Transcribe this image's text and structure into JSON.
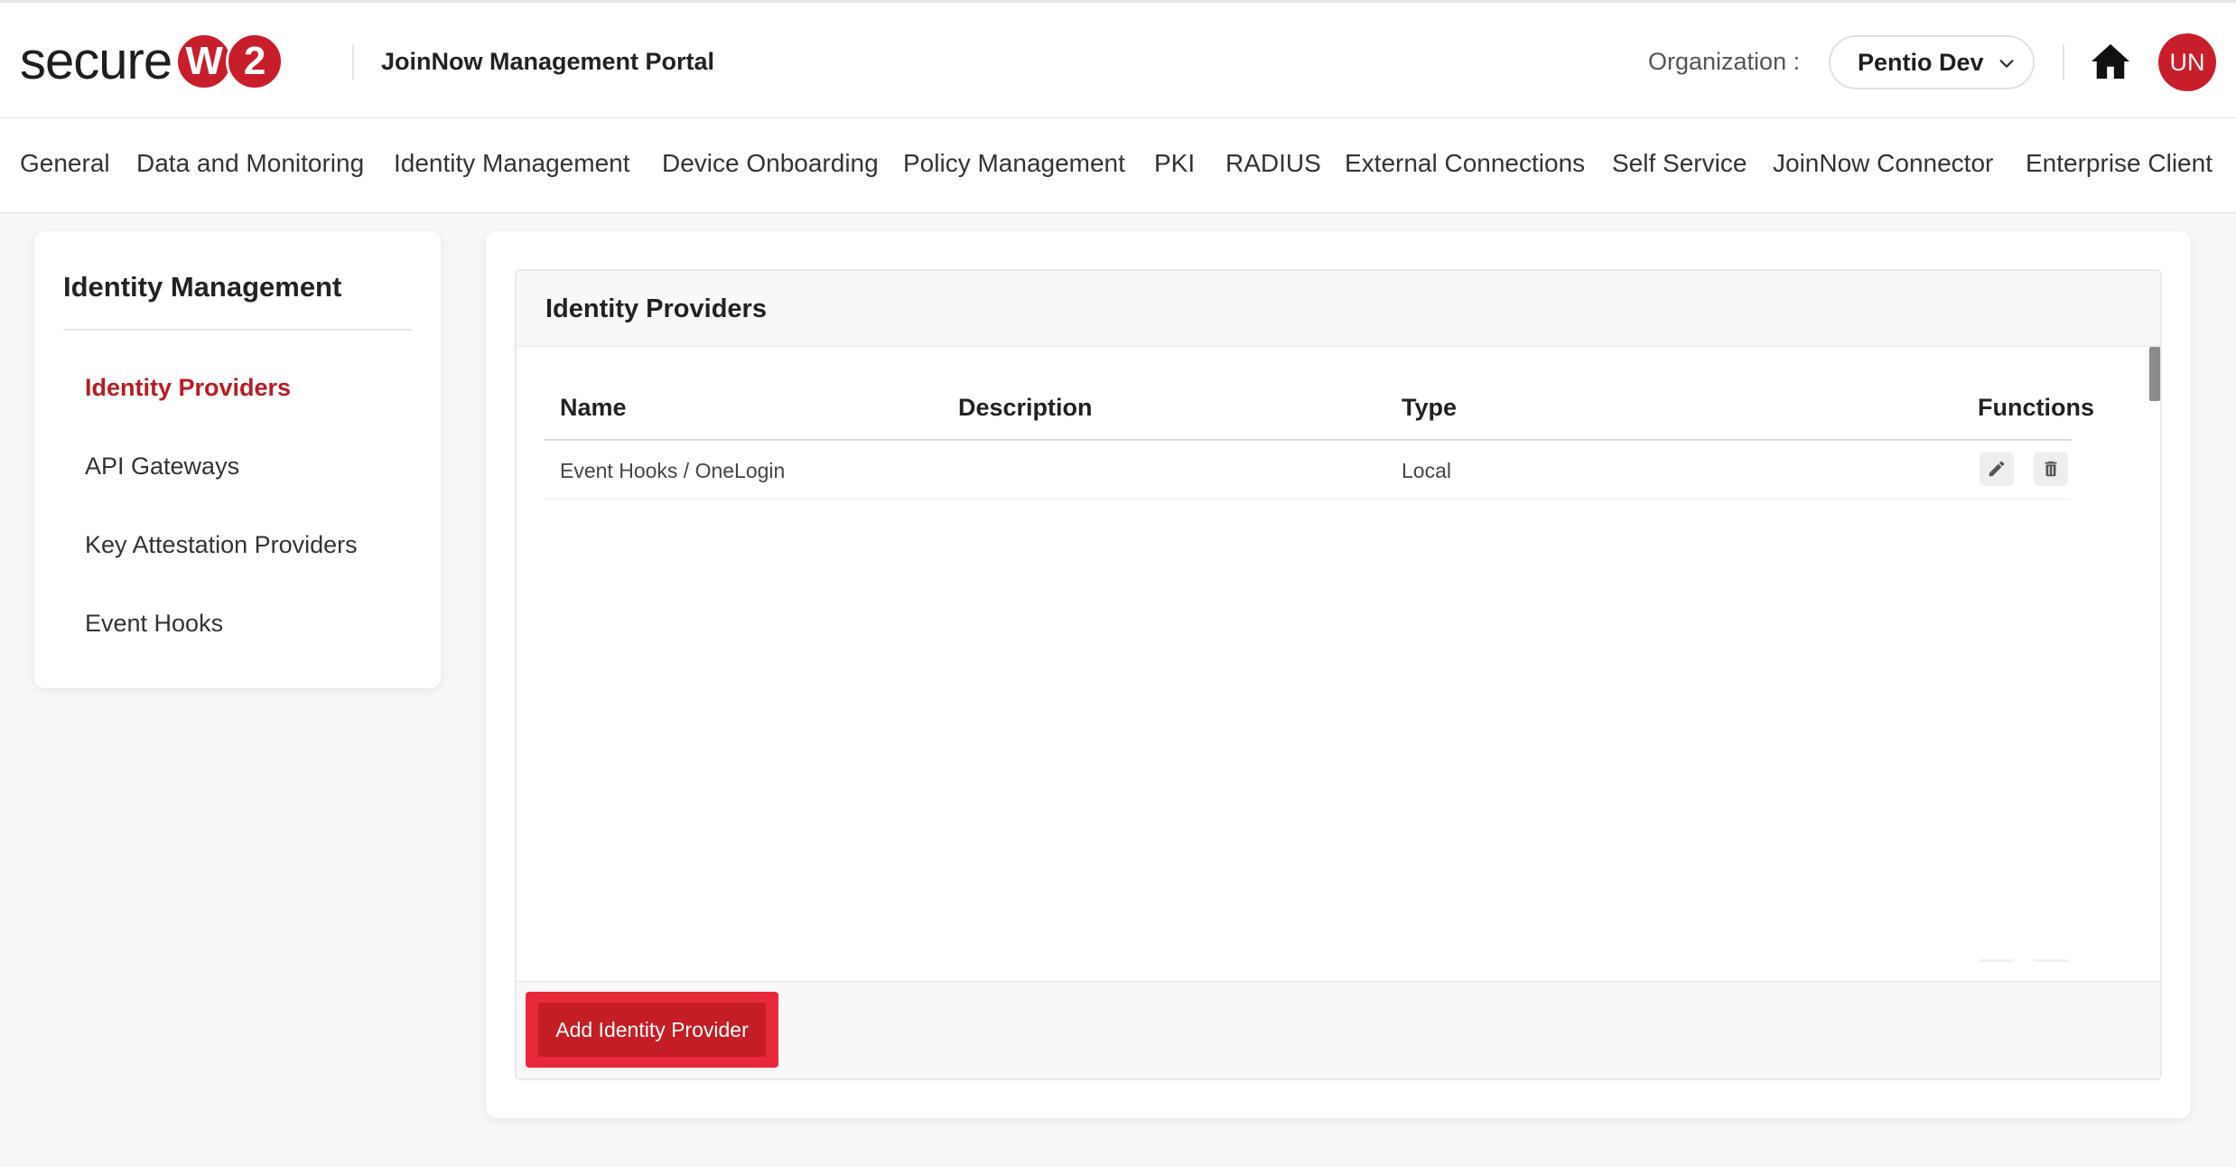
{
  "header": {
    "logo": {
      "text": "secure",
      "circle1": "W",
      "circle2": "2"
    },
    "portal_title": "JoinNow Management Portal",
    "org_label": "Organization :",
    "org_value": "Pentio Dev",
    "avatar_initials": "UN",
    "icons": {
      "home": "home-icon",
      "dropdown": "chevron-down-icon"
    }
  },
  "nav": {
    "items": [
      "General",
      "Data and Monitoring",
      "Identity Management",
      "Device Onboarding",
      "Policy Management",
      "PKI",
      "RADIUS",
      "External Connections",
      "Self Service",
      "JoinNow Connector",
      "Enterprise Client"
    ]
  },
  "sidebar": {
    "title": "Identity Management",
    "items": [
      {
        "label": "Identity Providers",
        "active": true
      },
      {
        "label": "API Gateways",
        "active": false
      },
      {
        "label": "Key Attestation Providers",
        "active": false
      },
      {
        "label": "Event Hooks",
        "active": false
      }
    ]
  },
  "panel": {
    "title": "Identity Providers",
    "columns": [
      "Name",
      "Description",
      "Type",
      "Functions"
    ],
    "rows": [
      {
        "name": "Event Hooks / OneLogin",
        "description": "",
        "type": "Local",
        "functions": [
          "pencil-icon",
          "trash-icon"
        ]
      }
    ],
    "add_button_label": "Add Identity Provider"
  },
  "colors": {
    "brand_red": "#c81e2b",
    "active_link": "#b71c25",
    "highlight_border": "#e8293c",
    "button_red": "#c41d25"
  }
}
